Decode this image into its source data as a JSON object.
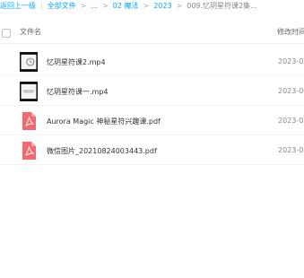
{
  "breadcrumb": {
    "back_label": "返回上一级",
    "all_files_label": "全部文件",
    "ellipsis_label": "...",
    "folder_1": "02 魔法",
    "folder_2": "2023",
    "current_folder": "009.忆玥星符课2集..."
  },
  "file_list": {
    "column_name_header": "文件名",
    "column_modified_header": "修改时间",
    "rows": [
      {
        "name": "忆玥星符课2.mp4",
        "modified": "2023-0",
        "type": "video",
        "icon": "video-thumbnail-icon"
      },
      {
        "name": "忆玥星符课一.mp4",
        "modified": "2023-0",
        "type": "video",
        "icon": "video-thumbnail-icon"
      },
      {
        "name": "Aurora Magic 神秘星符兴趣课.pdf",
        "modified": "2023-0",
        "type": "pdf",
        "icon": "pdf-file-icon"
      },
      {
        "name": "微信图片_20210824003443.pdf",
        "modified": "2023-0",
        "type": "pdf",
        "icon": "pdf-file-icon"
      }
    ]
  },
  "colors": {
    "link": "#06a7ff",
    "pdf_icon": "#f4686f"
  }
}
